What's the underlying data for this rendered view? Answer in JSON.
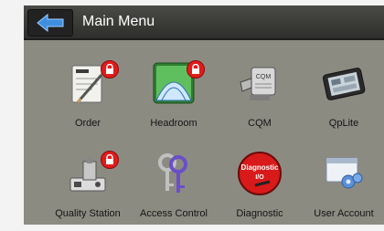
{
  "header": {
    "back_icon": "back-arrow-icon",
    "title": "Main Menu"
  },
  "colors": {
    "panel": "#8c8b82",
    "header": "#3a3a37",
    "lock": "#e11b1b",
    "back_arrow": "#3f8fe0"
  },
  "menu": [
    {
      "label": "Order",
      "icon": "order-form-icon",
      "locked": true
    },
    {
      "label": "Headroom",
      "icon": "headroom-icon",
      "locked": true
    },
    {
      "label": "CQM",
      "icon": "cqm-icon",
      "locked": false
    },
    {
      "label": "QpLite",
      "icon": "qplite-device-icon",
      "locked": false
    },
    {
      "label": "Quality Station",
      "icon": "quality-station-icon",
      "locked": true
    },
    {
      "label": "Access Control",
      "icon": "access-keys-icon",
      "locked": false
    },
    {
      "label": "Diagnostic",
      "icon": "diagnostic-icon",
      "locked": false
    },
    {
      "label": "User Account",
      "icon": "user-account-icon",
      "locked": false
    }
  ],
  "diagnostic_icon_text": [
    "Diagnostic",
    "I/O"
  ]
}
